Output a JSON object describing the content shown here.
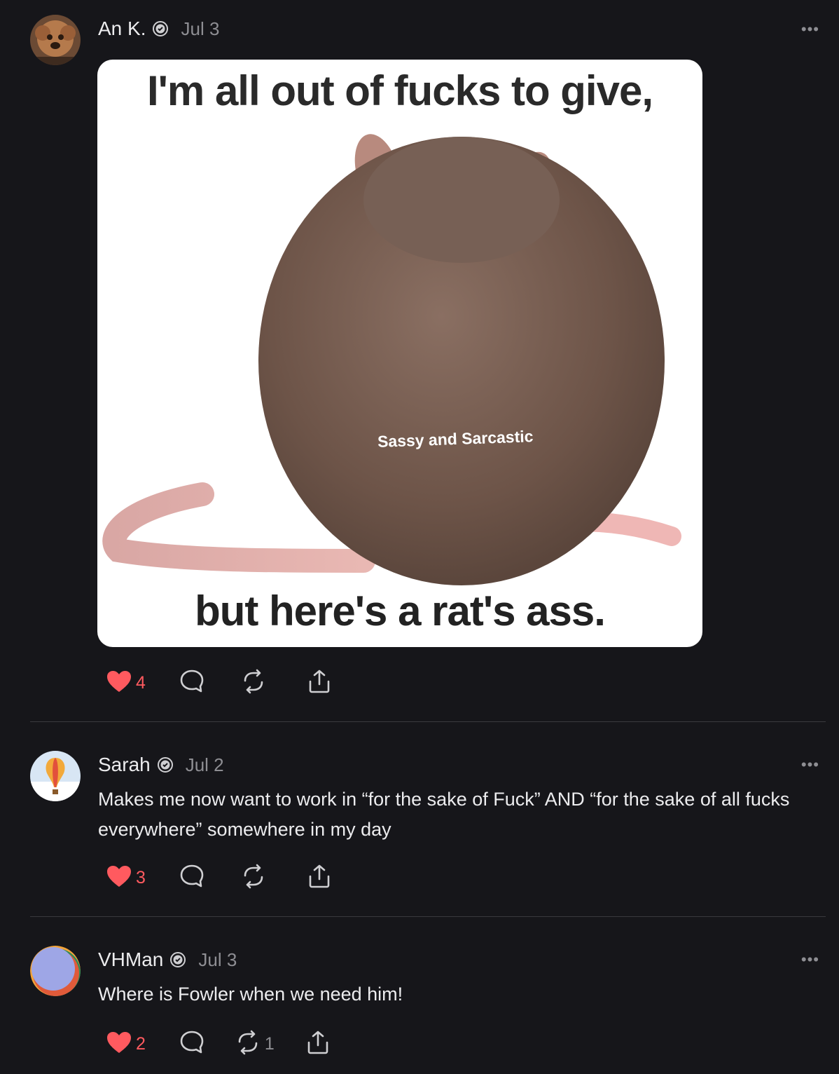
{
  "posts": [
    {
      "author": "An K.",
      "date": "Jul 3",
      "more": "•••",
      "image": {
        "top_text": "I'm all out of fucks to give,",
        "middle_text": "Sassy and Sarcastic",
        "bottom_text": "but here's a rat's ass."
      },
      "likes": "4",
      "reposts": ""
    },
    {
      "author": "Sarah",
      "date": "Jul 2",
      "more": "•••",
      "text": "Makes me now want to work in “for the sake of Fuck” AND “for the sake of all fucks everywhere” somewhere in my day",
      "likes": "3",
      "reposts": ""
    },
    {
      "author": "VHMan",
      "date": "Jul 3",
      "more": "•••",
      "text": "Where is Fowler when we need him!",
      "likes": "2",
      "reposts": "1"
    }
  ],
  "colors": {
    "background": "#16161a",
    "like": "#ff5a5f",
    "muted": "#8e8e93"
  },
  "icons": [
    "heart-icon",
    "comment-icon",
    "repost-icon",
    "share-icon",
    "verified-badge-icon",
    "more-icon"
  ]
}
